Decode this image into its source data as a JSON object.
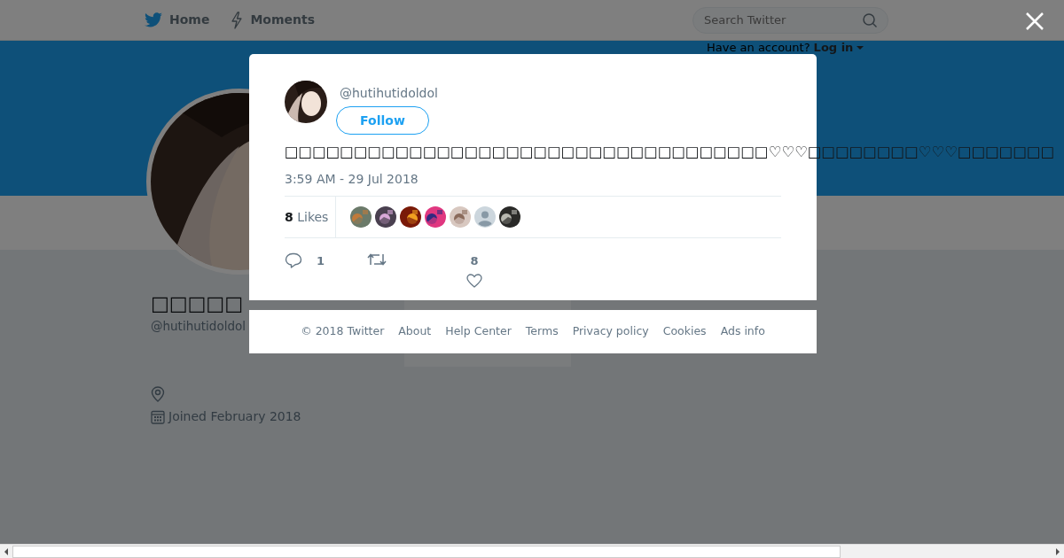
{
  "nav": {
    "items": [
      {
        "label": "Home"
      },
      {
        "label": "Moments"
      }
    ],
    "search": {
      "placeholder": "Search Twitter"
    },
    "account_prompt": "Have an account?",
    "login": "Log in"
  },
  "profile": {
    "name": "□□□□□",
    "handle": "@hutihutidoldol",
    "joined": "Joined February 2018"
  },
  "tweet": {
    "handle": "@hutihutidoldol",
    "follow": "Follow",
    "text": "□□□□□□□□□□□□□□□□□□□□□□□□□□□□□□□□□□□♡♡♡□□□□□□□□♡♡♡□□□□□□□",
    "time": "3:59 AM - 29 Jul 2018",
    "likes_count": "8",
    "likes_label": "Likes",
    "likers": [
      {
        "kind": "picture"
      },
      {
        "kind": "picture"
      },
      {
        "kind": "picture"
      },
      {
        "kind": "picture"
      },
      {
        "kind": "picture"
      },
      {
        "kind": "default"
      },
      {
        "kind": "picture"
      }
    ],
    "reply_count": "1",
    "like_count": "8"
  },
  "footer": [
    "© 2018 Twitter",
    "About",
    "Help Center",
    "Terms",
    "Privacy policy",
    "Cookies",
    "Ads info"
  ]
}
